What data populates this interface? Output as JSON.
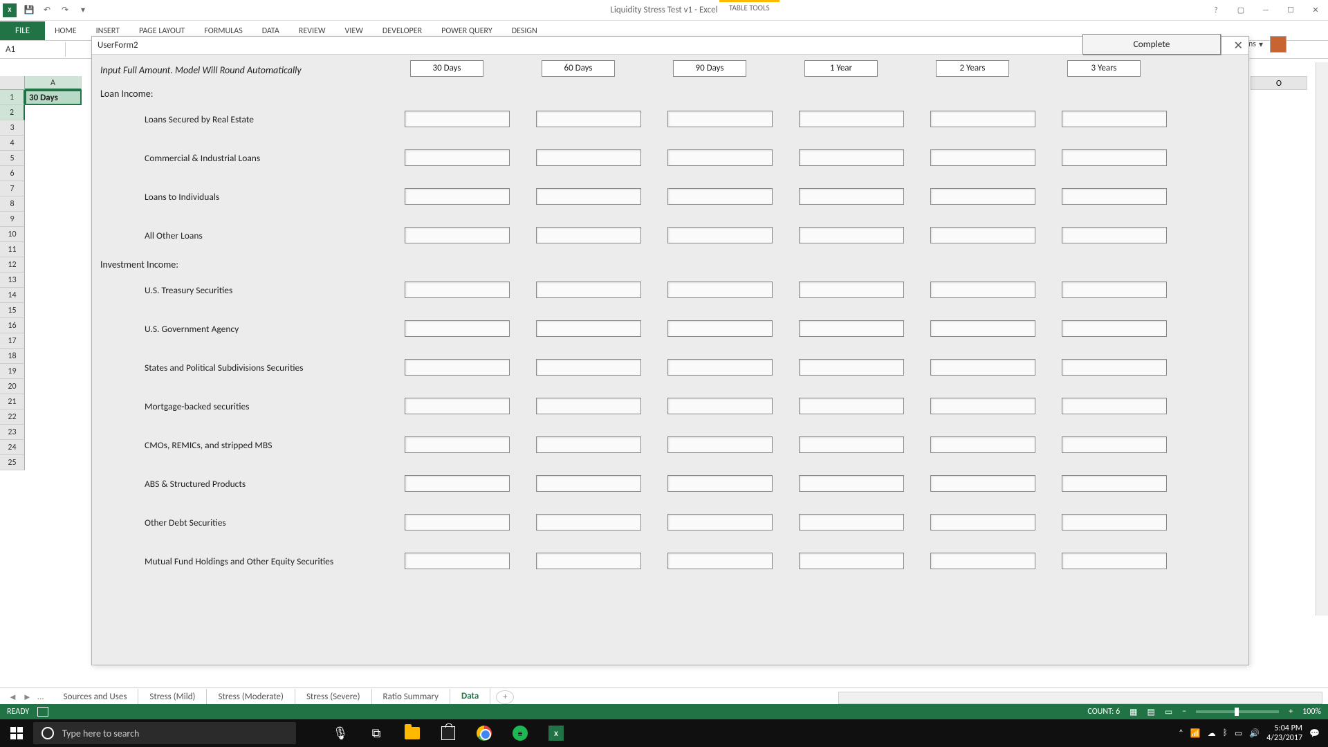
{
  "titlebar": {
    "app_title": "Liquidity Stress Test v1 - Excel",
    "table_tools": "TABLE TOOLS",
    "user_name": "th Evans"
  },
  "ribbon": {
    "file": "FILE",
    "tabs": [
      "HOME",
      "INSERT",
      "PAGE LAYOUT",
      "FORMULAS",
      "DATA",
      "REVIEW",
      "VIEW",
      "DEVELOPER",
      "POWER QUERY",
      "DESIGN"
    ]
  },
  "namebox": {
    "ref": "A1"
  },
  "columns": {
    "A": "A",
    "O": "O"
  },
  "cell_a1": "30 Days",
  "userform": {
    "title": "UserForm2",
    "instruction": "Input Full Amount. Model Will Round Automatically",
    "periods": [
      "30 Days",
      "60 Days",
      "90 Days",
      "1 Year",
      "2 Years",
      "3 Years"
    ],
    "loan_section": "Loan Income:",
    "loan_rows": [
      "Loans Secured by Real Estate",
      "Commercial & Industrial Loans",
      "Loans to Individuals",
      "All Other Loans"
    ],
    "inv_section": "Investment Income:",
    "inv_rows": [
      "U.S. Treasury Securities",
      "U.S. Government Agency",
      "States and Political Subdivisions Securities",
      "Mortgage-backed securities",
      "CMOs, REMICs, and stripped MBS",
      "ABS & Structured Products",
      "Other Debt Securities",
      "Mutual Fund Holdings and Other Equity Securities"
    ],
    "complete": "Complete"
  },
  "sheet_tabs": {
    "tabs": [
      "Sources and Uses",
      "Stress (Mild)",
      "Stress (Moderate)",
      "Stress (Severe)",
      "Ratio Summary",
      "Data"
    ],
    "active_index": 5,
    "ellipsis": "..."
  },
  "status": {
    "ready": "READY",
    "count": "COUNT: 6",
    "zoom": "100%"
  },
  "taskbar": {
    "search_placeholder": "Type here to search",
    "time": "5:04 PM",
    "date": "4/23/2017"
  }
}
